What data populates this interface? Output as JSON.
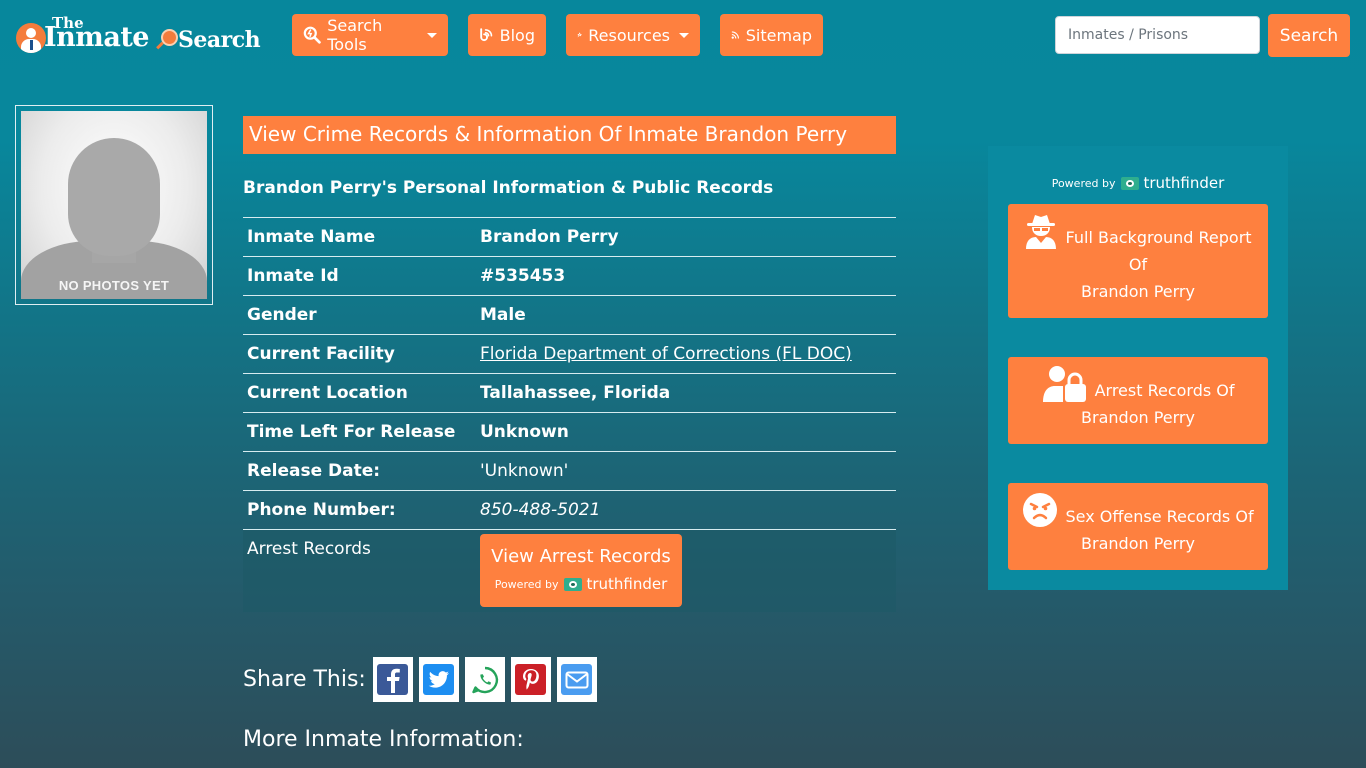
{
  "header": {
    "logo": {
      "the": "The",
      "inmate": "Inmate",
      "search": "Search"
    },
    "nav": [
      {
        "label": "Search Tools",
        "icon": "search-tools-icon",
        "has_dropdown": true
      },
      {
        "label": "Blog",
        "icon": "blog-icon",
        "has_dropdown": false
      },
      {
        "label": "Resources",
        "icon": "leaf-icon",
        "has_dropdown": true
      },
      {
        "label": "Sitemap",
        "icon": "rss-icon",
        "has_dropdown": false
      }
    ],
    "search": {
      "placeholder": "Inmates / Prisons",
      "value": "",
      "button_label": "Search"
    }
  },
  "photo": {
    "caption": "NO PHOTOS YET"
  },
  "main": {
    "title": "View Crime Records & Information Of Inmate Brandon Perry",
    "subtitle": "Brandon Perry's Personal Information & Public Records",
    "rows": [
      {
        "label": "Inmate Name",
        "value": "Brandon Perry"
      },
      {
        "label": "Inmate Id",
        "value": "#535453"
      },
      {
        "label": "Gender",
        "value": "Male"
      },
      {
        "label": "Current Facility",
        "value": "Florida Department of Corrections (FL DOC)"
      },
      {
        "label": "Current Location",
        "value": "Tallahassee, Florida"
      },
      {
        "label": "Time Left For Release",
        "value": "Unknown"
      },
      {
        "label": "Release Date:",
        "value": "'Unknown'"
      },
      {
        "label": "Phone Number:",
        "value": "850-488-5021"
      }
    ],
    "arrest": {
      "label": "Arrest Records",
      "button_label": "View Arrest Records",
      "powered_by": "Powered by",
      "brand": "truthfinder"
    },
    "share": {
      "label": "Share This:",
      "buttons": [
        {
          "name": "facebook",
          "color": "#3b5998"
        },
        {
          "name": "twitter",
          "color": "#1d8ef1"
        },
        {
          "name": "whatsapp",
          "color": "#25a35a"
        },
        {
          "name": "pinterest",
          "color": "#cb2027"
        },
        {
          "name": "email",
          "color": "#4a9cf0"
        }
      ]
    },
    "more_info": "More Inmate Information:"
  },
  "sidebar": {
    "powered_by": "Powered by",
    "brand": "truthfinder",
    "buttons": [
      {
        "line1": "Full Background Report",
        "line2": "Of",
        "line3": "Brandon Perry",
        "icon": "spy-icon"
      },
      {
        "line1": "Arrest Records Of",
        "line2": "Brandon Perry",
        "icon": "user-lock-icon"
      },
      {
        "line1": "Sex Offense Records Of",
        "line2": "Brandon Perry",
        "icon": "angry-face-icon"
      }
    ]
  },
  "colors": {
    "accent": "#fe803f",
    "background_top": "#07879c",
    "background_bottom": "#2d4d59",
    "sidebar": "#0a8aa0"
  }
}
